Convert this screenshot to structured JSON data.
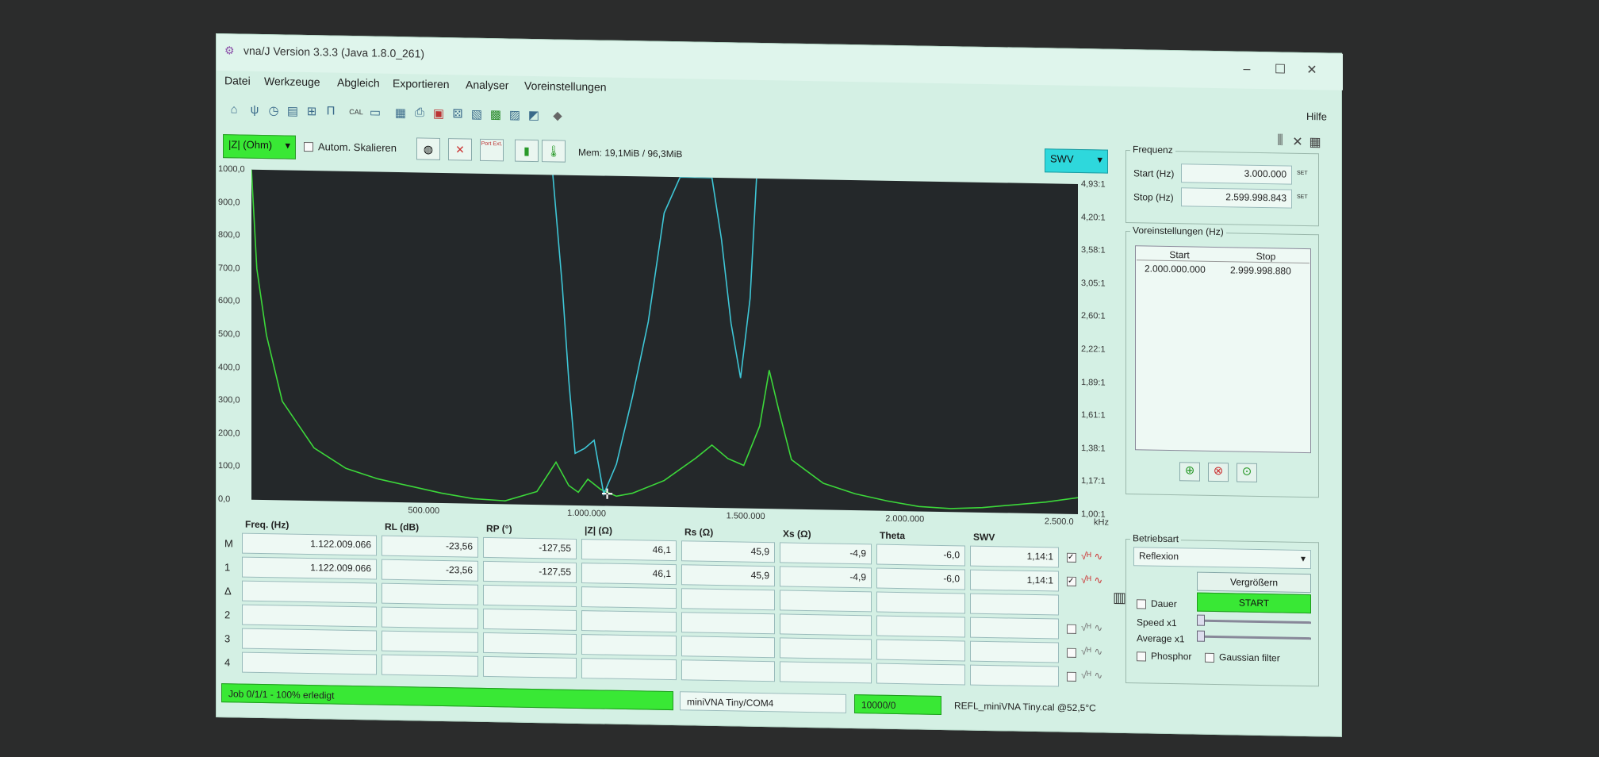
{
  "window": {
    "title": "vna/J Version 3.3.3 (Java 1.8.0_261)",
    "controls": [
      "–",
      "☐",
      "✕"
    ]
  },
  "menu": [
    "Datei",
    "Werkzeuge",
    "Abgleich",
    "Exportieren",
    "Analyser",
    "Voreinstellungen"
  ],
  "help": "Hilfe",
  "toolbar": {
    "cal_label": "CAL",
    "left_scale": "|Z| (Ohm)",
    "autoscale_label": "Autom. Skalieren",
    "port_ext_label": "Port Ext.",
    "mem": "Mem: 19,1MiB / 96,3MiB",
    "right_scale": "SWV"
  },
  "frequency": {
    "title": "Frequenz",
    "start_label": "Start (Hz)",
    "start_value": "3.000.000",
    "stop_label": "Stop (Hz)",
    "stop_value": "2.599.998.843",
    "set_label": "SET"
  },
  "presets": {
    "title": "Voreinstellungen (Hz)",
    "headers": [
      "Start",
      "Stop"
    ],
    "rows": [
      [
        "2.000.000.000",
        "2.999.998.880"
      ]
    ]
  },
  "mode": {
    "title": "Betriebsart",
    "selected": "Reflexion",
    "zoom_button": "Vergrößern",
    "start_button": "START",
    "continuous": "Dauer",
    "speed": "Speed x1",
    "average": "Average x1",
    "phosphor": "Phosphor",
    "gaussian": "Gaussian filter"
  },
  "chart_data": {
    "type": "line",
    "xlabel": "kHz",
    "x_ticks": [
      "500.000",
      "1.000.000",
      "1.500.000",
      "2.000.000",
      "2.500.0"
    ],
    "y_left_ticks": [
      "0,0",
      "100,0",
      "200,0",
      "300,0",
      "400,0",
      "500,0",
      "600,0",
      "700,0",
      "800,0",
      "900,0",
      "1000,0"
    ],
    "y_right_ticks": [
      "1,00:1",
      "1,17:1",
      "1,38:1",
      "1,61:1",
      "1,89:1",
      "2,22:1",
      "2,60:1",
      "3,05:1",
      "3,58:1",
      "4,20:1",
      "4,93:1"
    ],
    "xlim": [
      3000,
      2600000
    ],
    "ylim_left": [
      0,
      1000
    ],
    "ylim_right": [
      1.0,
      4.93
    ],
    "series": [
      {
        "color": "#3cd83a",
        "axis": "left",
        "x": [
          3000,
          20000,
          50000,
          100000,
          200000,
          300000,
          400000,
          500000,
          600000,
          700000,
          800000,
          900000,
          960000,
          1000000,
          1030000,
          1060000,
          1100000,
          1150000,
          1200000,
          1300000,
          1400000,
          1450000,
          1500000,
          1550000,
          1600000,
          1630000,
          1660000,
          1700000,
          1800000,
          1900000,
          2000000,
          2100000,
          2200000,
          2300000,
          2400000,
          2500000,
          2600000
        ],
        "y": [
          1000,
          700,
          500,
          300,
          160,
          100,
          70,
          50,
          30,
          15,
          10,
          40,
          130,
          60,
          40,
          80,
          50,
          30,
          40,
          80,
          150,
          190,
          150,
          130,
          250,
          420,
          300,
          150,
          80,
          50,
          30,
          15,
          10,
          15,
          25,
          35,
          50
        ]
      },
      {
        "color": "#3ec6d6",
        "axis": "right",
        "x": [
          950000,
          980000,
          1000000,
          1020000,
          1050000,
          1080000,
          1110000,
          1150000,
          1200000,
          1250000,
          1300000,
          1350000,
          1400000,
          1450000,
          1480000,
          1510000,
          1540000,
          1570000,
          1590000
        ],
        "y": [
          4.93,
          3.6,
          2.5,
          1.62,
          1.68,
          1.78,
          1.14,
          1.5,
          2.3,
          3.2,
          4.5,
          4.93,
          4.93,
          4.93,
          4.2,
          3.2,
          2.55,
          3.5,
          4.93
        ]
      }
    ]
  },
  "table": {
    "headers": [
      "Freq. (Hz)",
      "RL (dB)",
      "RP (°)",
      "|Z| (Ω)",
      "Rs (Ω)",
      "Xs (Ω)",
      "Theta",
      "SWV"
    ],
    "rows": [
      {
        "label": "M",
        "values": [
          "1.122.009.066",
          "-23,56",
          "-127,55",
          "46,1",
          "45,9",
          "-4,9",
          "-6,0",
          "1,14:1"
        ]
      },
      {
        "label": "1",
        "values": [
          "1.122.009.066",
          "-23,56",
          "-127,55",
          "46,1",
          "45,9",
          "-4,9",
          "-6,0",
          "1,14:1"
        ]
      },
      {
        "label": "Δ",
        "values": [
          "",
          "",
          "",
          "",
          "",
          "",
          "",
          ""
        ]
      },
      {
        "label": "2",
        "values": [
          "",
          "",
          "",
          "",
          "",
          "",
          "",
          ""
        ]
      },
      {
        "label": "3",
        "values": [
          "",
          "",
          "",
          "",
          "",
          "",
          "",
          ""
        ]
      },
      {
        "label": "4",
        "values": [
          "",
          "",
          "",
          "",
          "",
          "",
          "",
          ""
        ]
      }
    ]
  },
  "status": {
    "job": "Job 0/1/1 - 100% erledigt",
    "device": "miniVNA Tiny/COM4",
    "samples": "10000/0",
    "cal": "REFL_miniVNA Tiny.cal @52,5°C"
  }
}
